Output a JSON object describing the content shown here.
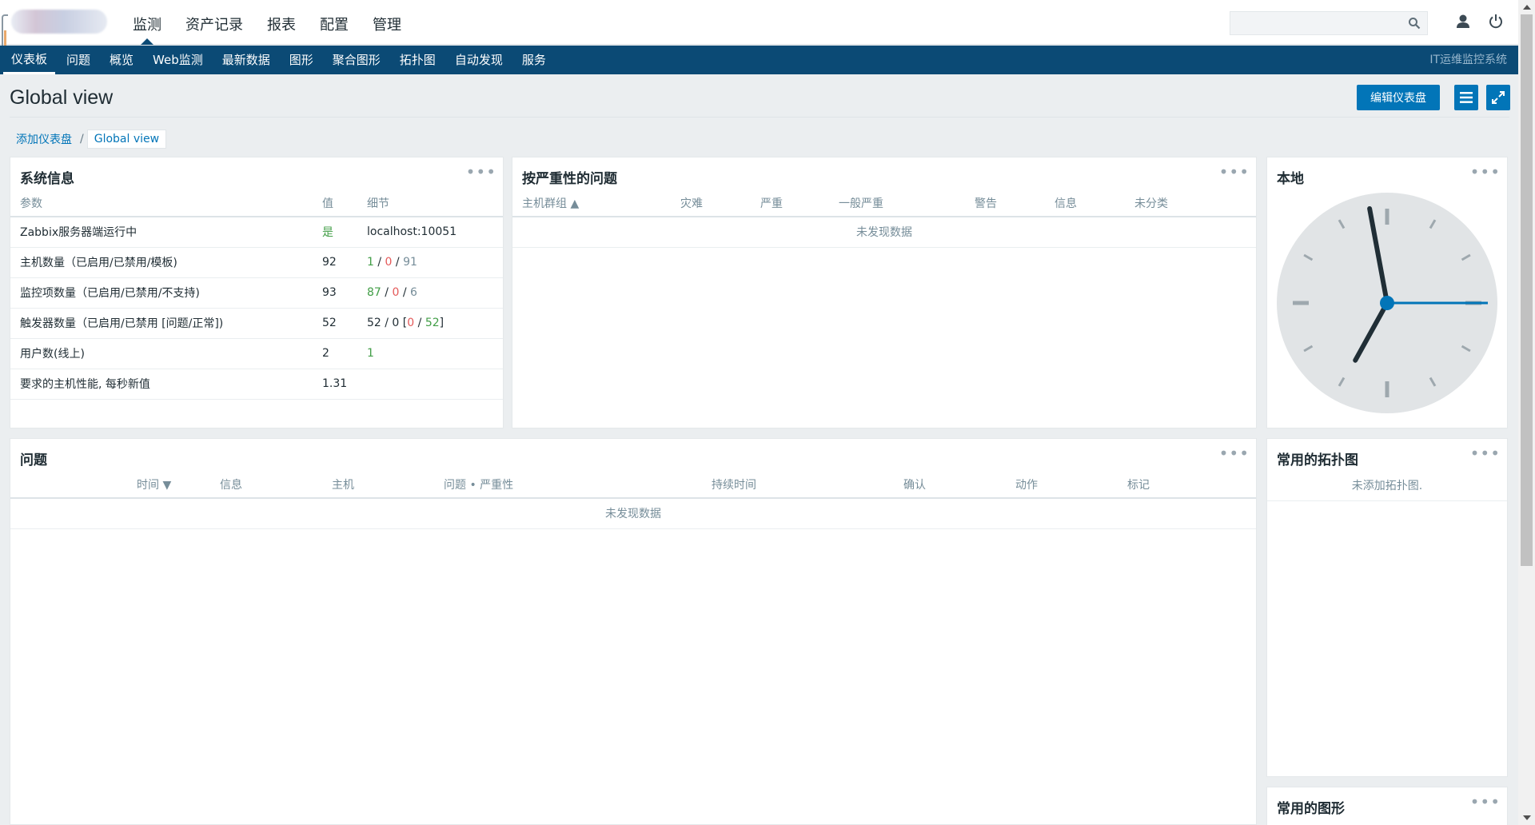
{
  "header": {
    "main_menu": [
      "监测",
      "资产记录",
      "报表",
      "配置",
      "管理"
    ],
    "search_placeholder": ""
  },
  "submenu": {
    "items": [
      "仪表板",
      "问题",
      "概览",
      "Web监测",
      "最新数据",
      "图形",
      "聚合图形",
      "拓扑图",
      "自动发现",
      "服务"
    ],
    "right_text": "IT运维监控系统"
  },
  "page": {
    "title": "Global view",
    "edit_button": "编辑仪表盘",
    "breadcrumb": [
      "添加仪表盘",
      "Global view"
    ]
  },
  "sysinfo": {
    "title": "系统信息",
    "headers": [
      "参数",
      "值",
      "细节"
    ],
    "rows": [
      {
        "param": "Zabbix服务器端运行中",
        "value": "是",
        "detail": "localhost:10051"
      },
      {
        "param": "主机数量（已启用/已禁用/模板)",
        "value": "92",
        "d1": "1",
        "d2": "0",
        "d3": "91"
      },
      {
        "param": "监控项数量（已启用/已禁用/不支持)",
        "value": "93",
        "d1": "87",
        "d2": "0",
        "d3": "6"
      },
      {
        "param": "触发器数量（已启用/已禁用 [问题/正常])",
        "value": "52",
        "d1": "52 / 0 [",
        "d2": "0",
        "d3": "52",
        "d4": "]"
      },
      {
        "param": "用户数(线上)",
        "value": "2",
        "detail": "1"
      },
      {
        "param": "要求的主机性能, 每秒新值",
        "value": "1.31",
        "detail": ""
      }
    ]
  },
  "severity": {
    "title": "按严重性的问题",
    "headers": [
      "主机群组 ▲",
      "灾难",
      "严重",
      "一般严重",
      "警告",
      "信息",
      "未分类"
    ],
    "nodata": "未发现数据"
  },
  "clock": {
    "title": "本地",
    "time": {
      "hours": 6,
      "minutes": 58,
      "seconds": 15
    }
  },
  "problems": {
    "title": "问题",
    "headers": [
      "时间 ▼",
      "信息",
      "主机",
      "问题 • 严重性",
      "持续时间",
      "确认",
      "动作",
      "标记"
    ],
    "nodata": "未发现数据"
  },
  "maps": {
    "title": "常用的拓扑图",
    "empty": "未添加拓扑图."
  },
  "graphs": {
    "title": "常用的图形"
  },
  "colors": {
    "brand": "#0b4a75",
    "accent": "#0275b8",
    "ok": "#429e47",
    "problem": "#e45959"
  }
}
